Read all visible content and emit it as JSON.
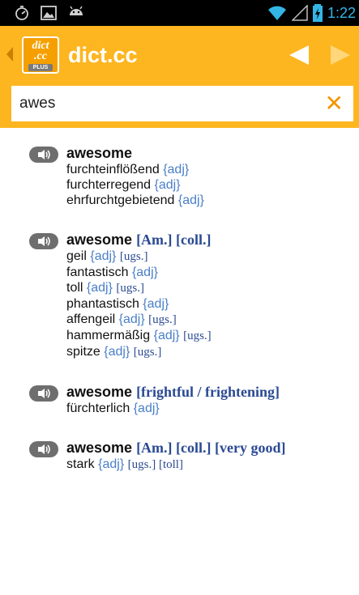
{
  "status_bar": {
    "time": "1:22",
    "icons": [
      "stopwatch-icon",
      "image-icon",
      "android-icon",
      "wifi-icon",
      "signal-icon",
      "battery-icon"
    ]
  },
  "app_bar": {
    "title": "dict.cc",
    "icon_line1": "dict",
    "icon_line2": ".cc",
    "icon_badge": "PLUS",
    "accent_color": "#fdb620"
  },
  "search": {
    "value": "awes",
    "placeholder": ""
  },
  "results": [
    {
      "term": "awesome",
      "qualifiers": "",
      "translations": [
        {
          "word": "furchteinflößend",
          "tag": "{adj}",
          "extra": ""
        },
        {
          "word": "furchterregend",
          "tag": "{adj}",
          "extra": ""
        },
        {
          "word": "ehrfurchtgebietend",
          "tag": "{adj}",
          "extra": ""
        }
      ]
    },
    {
      "term": "awesome",
      "qualifiers": "[Am.] [coll.]",
      "translations": [
        {
          "word": "geil",
          "tag": "{adj}",
          "extra": "[ugs.]"
        },
        {
          "word": "fantastisch",
          "tag": "{adj}",
          "extra": ""
        },
        {
          "word": "toll",
          "tag": "{adj}",
          "extra": "[ugs.]"
        },
        {
          "word": "phantastisch",
          "tag": "{adj}",
          "extra": ""
        },
        {
          "word": "affengeil",
          "tag": "{adj}",
          "extra": "[ugs.]"
        },
        {
          "word": "hammermäßig",
          "tag": "{adj}",
          "extra": "[ugs.]"
        },
        {
          "word": "spitze",
          "tag": "{adj}",
          "extra": "[ugs.]"
        }
      ]
    },
    {
      "term": "awesome",
      "qualifiers": "[frightful / frightening]",
      "translations": [
        {
          "word": "fürchterlich",
          "tag": "{adj}",
          "extra": ""
        }
      ]
    },
    {
      "term": "awesome",
      "qualifiers": "[Am.] [coll.] [very good]",
      "translations": [
        {
          "word": "stark",
          "tag": "{adj}",
          "extra": "[ugs.] [toll]"
        }
      ]
    }
  ]
}
